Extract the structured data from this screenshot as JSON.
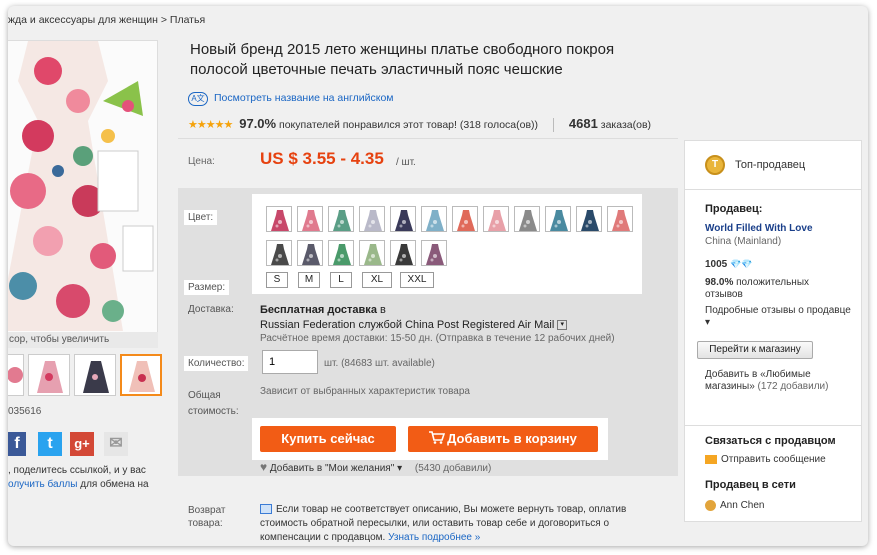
{
  "breadcrumb": "жда и аксессуары для женщин > Платья",
  "left": {
    "zoom_hint": "сор, чтобы увеличить",
    "product_id": "035616",
    "share_text_1": ", поделитесь ссылкой, и у вас",
    "share_link": "олучить баллы",
    "share_text_2": " для обмена на"
  },
  "product": {
    "title": "Новый бренд 2015 лето женщины платье свободного покроя полосой цветочные печать эластичный пояс чешские",
    "translate_icon": "A文",
    "translate_link": "Посмотреть название на английском",
    "stars": "★★★★★",
    "rating_pct": "97.0%",
    "rating_text": "покупателей понравился этот товар! (318 голоса(ов))",
    "orders_count": "4681",
    "orders_label": "заказа(ов)"
  },
  "price": {
    "label": "Цена:",
    "value": "US $ 3.55 - 4.35",
    "unit": "/ шт."
  },
  "options": {
    "color_label": "Цвет:",
    "size_label": "Размер:",
    "sizes": [
      "S",
      "M",
      "L",
      "XL",
      "XXL"
    ],
    "swatch_colors": [
      "#c8486a",
      "#e07a8e",
      "#5a9e86",
      "#b9b9c9",
      "#3a3a5a",
      "#7fb0c8",
      "#e06a5a",
      "#e8a0a8",
      "#8a8a8a",
      "#4a8aa0",
      "#2a4a6a",
      "#e07a7a",
      "#4a4a4a",
      "#5a5a6a",
      "#4a9a6a",
      "#9ab88a",
      "#3a3a3a",
      "#8a5a7a"
    ]
  },
  "shipping": {
    "label": "Доставка:",
    "free": "Бесплатная доставка",
    "to": " в",
    "line": "Russian Federation службой China Post Registered Air Mail",
    "dropdown_glyph": "▾",
    "time": "Расчётное время доставки: 15-50 дн. (Отправка в течение 12 рабочих дней)"
  },
  "quantity": {
    "label": "Количество:",
    "value": "1",
    "unit": "шт.",
    "available": "(84683 шт. available)"
  },
  "total": {
    "label_1": "Общая",
    "label_2": "стоимость:",
    "note": "Зависит от выбранных характеристик товара"
  },
  "buttons": {
    "buy_now": "Купить сейчас",
    "add_to_cart": "Добавить в корзину"
  },
  "wishlist": {
    "heart": "♥",
    "label": "Добавить в \"Мои желания\"",
    "caret": "▾",
    "count": "(5430 добавили)"
  },
  "returns": {
    "label_1": "Возврат",
    "label_2": "товара:",
    "text": "Если товар не соответствует описанию, Вы можете вернуть товар, оплатив стоимость обратной пересылки, или оставить товар себе и договориться о компенсации с продавцом. ",
    "link": "Узнать подробнее",
    "link_glyph": "»"
  },
  "seller": {
    "badge": "T",
    "top_seller": "Топ-продавец",
    "seller_label": "Продавец:",
    "store_name": "World Filled With Love",
    "location": "China (Mainland)",
    "score": "1005",
    "diamonds": "💎💎",
    "positive_pct": "98.0%",
    "positive_text": "положительных",
    "reviews_word": "отзывов",
    "detailed_reviews": "Подробные отзывы о продавце",
    "reviews_caret": "▾",
    "go_to_store": "Перейти к магазину",
    "add_favorites_1": "Добавить в «Любимые",
    "add_favorites_2": "магазины»",
    "favorites_count": "(172 добавили)",
    "contact_title": "Связаться с продавцом",
    "send_message": "Отправить сообщение",
    "online_title": "Продавец в сети",
    "online_name": "Ann Chen"
  },
  "social": {
    "facebook": "f",
    "twitter": "t",
    "gplus": "g+",
    "email": "✉"
  }
}
